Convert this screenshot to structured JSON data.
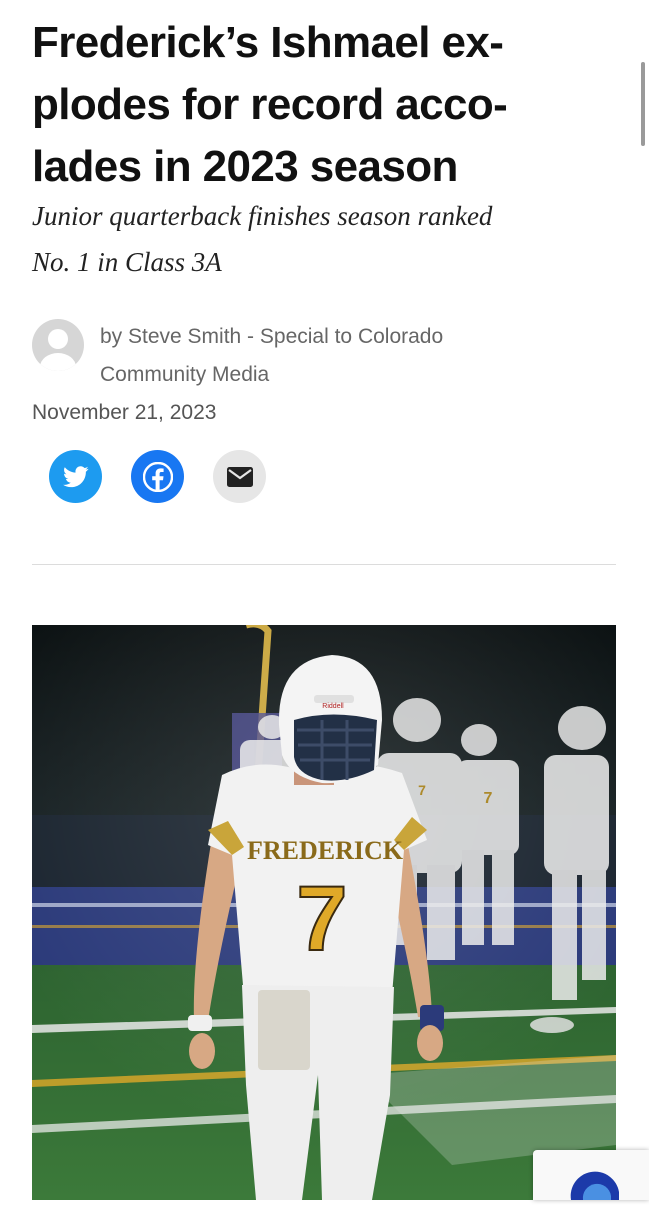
{
  "article": {
    "headline_lines": [
      "Frederick’s Ishmael ex-",
      "plodes for record acco-",
      "lades in 2023 season"
    ],
    "subhead_lines": [
      "Junior quarterback finishes season ranked",
      "No. 1 in Class 3A"
    ],
    "byline_lines": [
      "by Steve Smith - Special to Colorado",
      "Community Media"
    ],
    "date": "November 21, 2023"
  },
  "share": [
    {
      "name": "twitter",
      "icon": "twitter-bird-icon",
      "color": "#1d9bf0"
    },
    {
      "name": "facebook",
      "icon": "facebook-f-icon",
      "color": "#1877f2"
    },
    {
      "name": "email",
      "icon": "envelope-icon",
      "color": "#e6e6e6"
    }
  ],
  "photo": {
    "jersey_text": "FREDERICK",
    "jersey_number": "7",
    "helmet_brand": "Riddell"
  },
  "colors": {
    "jersey_gold": "#e0a928",
    "field_green": "#2f6a32",
    "field_blue": "#2b3a7a"
  }
}
